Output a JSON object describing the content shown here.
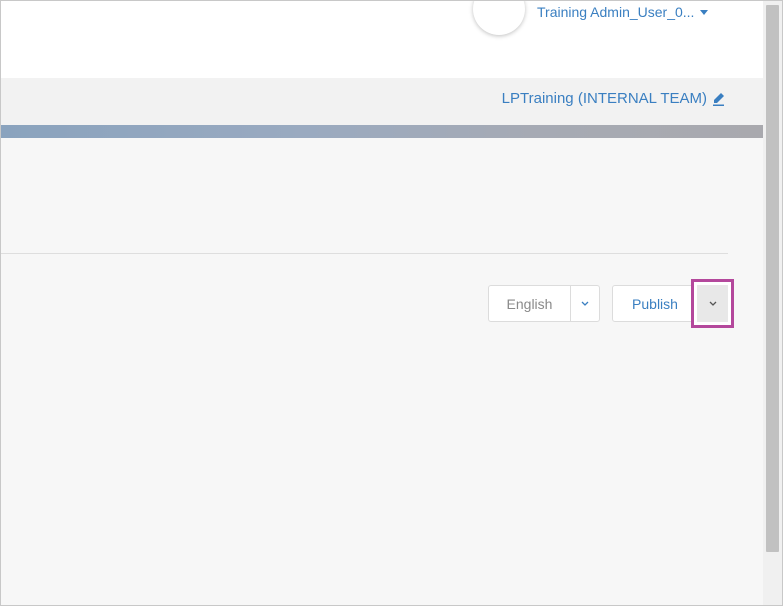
{
  "header": {
    "user_menu_label": "Training Admin_User_0...",
    "org_label": "LPTraining (INTERNAL TEAM)"
  },
  "toolbar": {
    "language_selected": "English",
    "publish_label": "Publish"
  },
  "colors": {
    "link_blue": "#3a7fc1",
    "highlight_border": "#b4489c"
  },
  "icons": {
    "user_menu_caret": "caret-down-icon",
    "org_edit": "pencil-icon",
    "language_toggle": "chevron-down-icon",
    "publish_toggle": "chevron-down-icon"
  }
}
